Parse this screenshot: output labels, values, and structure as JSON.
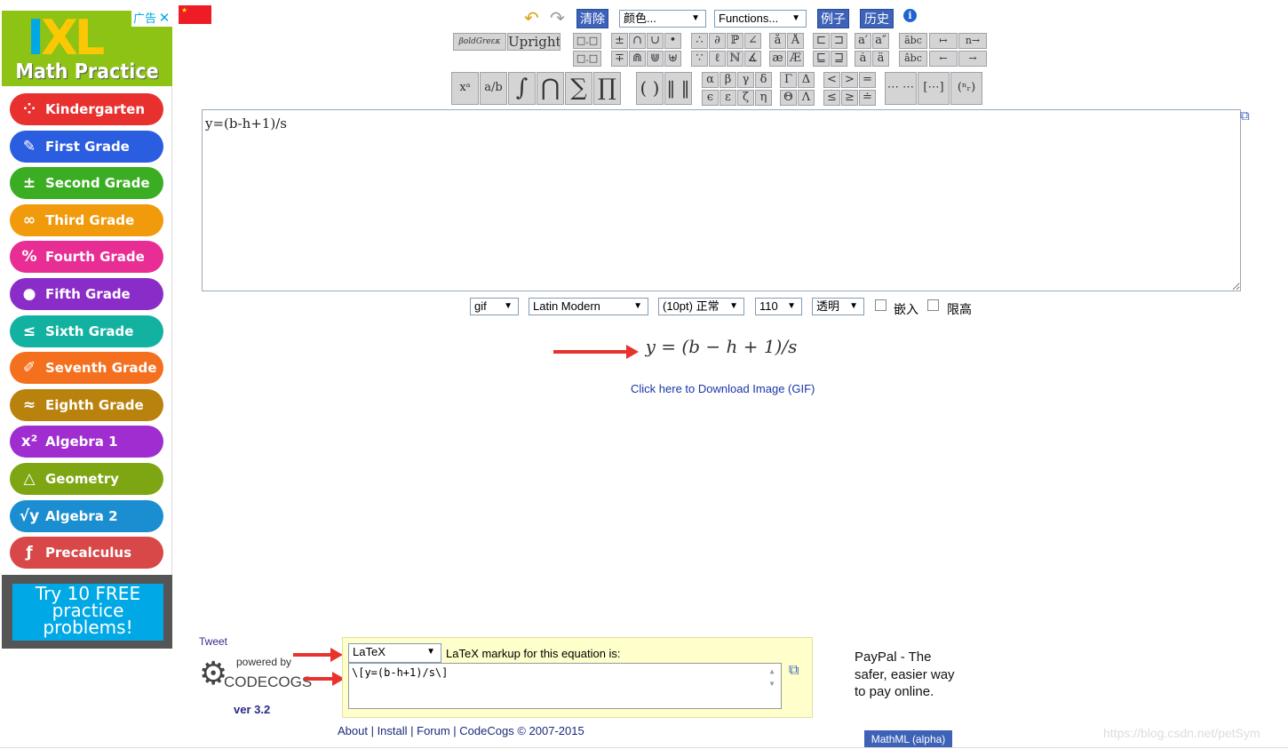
{
  "ad": {
    "logo_text": "IXL",
    "tagline": "Math Practice",
    "ad_label": "广告",
    "close": "✕",
    "grades": [
      {
        "label": "Kindergarten",
        "icon": "⁘",
        "color": "#e8302f"
      },
      {
        "label": "First Grade",
        "icon": "✎",
        "color": "#2a5de0"
      },
      {
        "label": "Second Grade",
        "icon": "±",
        "color": "#3aad22"
      },
      {
        "label": "Third Grade",
        "icon": "∞",
        "color": "#f09a0c"
      },
      {
        "label": "Fourth Grade",
        "icon": "%",
        "color": "#e82d94"
      },
      {
        "label": "Fifth Grade",
        "icon": "●",
        "color": "#8a2dc8"
      },
      {
        "label": "Sixth Grade",
        "icon": "≤",
        "color": "#13b2a0"
      },
      {
        "label": "Seventh Grade",
        "icon": "✐",
        "color": "#f5701e"
      },
      {
        "label": "Eighth Grade",
        "icon": "≈",
        "color": "#b9820c"
      },
      {
        "label": "Algebra 1",
        "icon": "x²",
        "color": "#a02dd0"
      },
      {
        "label": "Geometry",
        "icon": "△",
        "color": "#7ea612"
      },
      {
        "label": "Algebra 2",
        "icon": "√y",
        "color": "#1a8ed0"
      },
      {
        "label": "Precalculus",
        "icon": "ƒ",
        "color": "#d84848"
      }
    ],
    "cta": "Try 10 FREE practice problems!"
  },
  "toolbar": {
    "undo": "↶",
    "redo": "↷",
    "clear": "清除",
    "color_select": "颜色...",
    "functions_select": "Functions...",
    "examples": "例子",
    "history": "历史",
    "info": "i"
  },
  "symbols": {
    "style": [
      "βoldGreεκ",
      "Upright"
    ],
    "groups_small": [
      [
        [
          "□.□"
        ],
        [
          "□.□"
        ]
      ],
      [
        [
          "±",
          "∩",
          "∪",
          "•"
        ],
        [
          "∓",
          "⋒",
          "⋓",
          "⊎"
        ]
      ],
      [
        [
          "∴",
          "∂",
          "ℙ",
          "∠"
        ],
        [
          "∵",
          "ℓ",
          "ℕ",
          "∡"
        ]
      ],
      [
        [
          "å",
          "Å"
        ],
        [
          "æ",
          "Æ"
        ]
      ],
      [
        [
          "⊏",
          "⊐"
        ],
        [
          "⊑",
          "⊒"
        ]
      ],
      [
        [
          "a′",
          "a″"
        ],
        [
          "ȧ",
          "ä"
        ]
      ],
      [
        [
          "ãbc"
        ],
        [
          "âbc"
        ]
      ],
      [
        [
          "↦",
          "n→"
        ],
        [
          "←",
          "→"
        ]
      ]
    ],
    "big": [
      "xᵃ",
      "a/b",
      "∫",
      "⋂",
      "∑",
      "∏"
    ],
    "delims": [
      "( )",
      "‖ ‖"
    ],
    "greek": [
      [
        "α",
        "β",
        "γ",
        "δ"
      ],
      [
        "ϵ",
        "ε",
        "ζ",
        "η"
      ]
    ],
    "greek_cap": [
      [
        "Γ",
        "Δ"
      ],
      [
        "Θ",
        "Λ"
      ]
    ],
    "relations": [
      [
        "<",
        ">",
        "="
      ],
      [
        "≤",
        "≥",
        "≐"
      ]
    ],
    "matrices": [
      "⋯ ⋯",
      "[⋯]",
      "(ⁿᵣ)"
    ]
  },
  "editor": {
    "value": "y=(b-h+1)/s"
  },
  "options": {
    "format": "gif",
    "font": "Latin Modern",
    "size": "(10pt) 正常",
    "dpi": "110",
    "background": "透明",
    "embed_label": "嵌入",
    "embed_checked": false,
    "limit_label": "限高",
    "limit_checked": false
  },
  "preview": {
    "equation": "y = (b − h + 1)/s",
    "download_link": "Click here to Download Image (GIF)"
  },
  "bottom": {
    "tweet": "Tweet",
    "powered_by": "powered by",
    "brand": "CODECOGS",
    "version": "ver 3.2",
    "markup_select": "LaTeX",
    "markup_label": "LaTeX markup for this equation is:",
    "markup_value": "\\[y=(b-h+1)/s\\]",
    "footer": "About | Install | Forum | CodeCogs © 2007-2015",
    "paypal_alt": "PayPal - The safer, easier way to pay online.",
    "mathml": "MathML (alpha)",
    "watermark": "https://blog.csdn.net/petSym"
  },
  "colors": {
    "accent": "#3d62b8",
    "note_bg": "#ffffcc",
    "arrow": "#e8322e"
  }
}
